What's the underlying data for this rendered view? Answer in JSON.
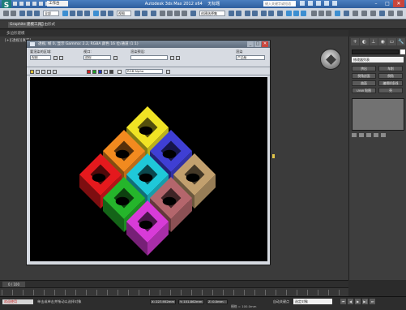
{
  "app": {
    "title": "Autodesk 3ds Max 2012 x64",
    "file": "无标题",
    "logo": "S",
    "workspace": "工作台",
    "help_search_placeholder": "键入关键字或短语",
    "window_controls": {
      "minimize": "–",
      "maximize": "□",
      "close": "✕"
    }
  },
  "toolbar": {
    "selection_filter": "全部",
    "view_dropdown": "视图",
    "named_selection": "创建选择集"
  },
  "ribbon": {
    "tabs": [
      "Graphite 建模工具",
      "自由形式"
    ],
    "sub_label": "多边形建模"
  },
  "viewport": {
    "label": "[+][透视][真实]"
  },
  "render_window": {
    "title": "透视, 帧 0, 显示 Gamma: 2.2, RGBA 颜色 16 位/通道 (1:1)",
    "controls": {
      "minimize": "_",
      "maximize": "□",
      "close": "✕"
    },
    "area_to_render_label": "要渲染的区域:",
    "area_to_render_value": "视图",
    "viewport_label": "视口:",
    "viewport_value": "透视",
    "preset_label": "渲染预设:",
    "preset_value": "",
    "render_label": "渲染",
    "render_mode_value": "产品级",
    "channel_value": "RGB Alpha"
  },
  "command_panel": {
    "tabs": [
      "+",
      "◐",
      "⊥",
      "◉",
      "▭",
      "🔧"
    ],
    "modifier_list": "修改器列表",
    "buttons": [
      "挤出",
      "车削",
      "倒角剖面",
      "倒角",
      "曲面",
      "编辑样条线",
      "UVW 贴图",
      "壳",
      "编辑多边形",
      "扫描"
    ]
  },
  "bottom": {
    "time_slider": "0 / 100",
    "maxscript_label": "欢迎使用",
    "status_message": "单击或单击并拖动以选择对象",
    "coord_x": "X: 227.952mm",
    "coord_y": "Y: 151.862mm",
    "coord_z": "Z: 0.0mm",
    "grid": "栅格 = 100.0mm",
    "autokey": "自动关键点",
    "setkey_filter": "选定对象",
    "add_time_tag": "添加时间标记",
    "playback": [
      "⏮",
      "◀",
      "▶",
      "▶|",
      "⏭"
    ]
  },
  "colors": {
    "title_bar": "#3b6fae",
    "viewport_bg": "#3b3b3b",
    "render_bg": "#000000",
    "tiles": [
      "#f0e324",
      "#f28a1f",
      "#3f3fd4",
      "#e5191d",
      "#1fc8d9",
      "#c2a06e",
      "#25b52b",
      "#b4666c",
      "#d83bd8"
    ]
  }
}
